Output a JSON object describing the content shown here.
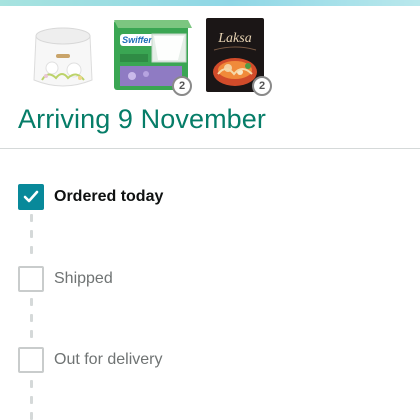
{
  "shipment": {
    "items": [
      {
        "icon": "cotton-pads-product-image",
        "quantity": ""
      },
      {
        "icon": "swiffer-cloths-product-image",
        "brand": "Swiffer",
        "quantity": "2"
      },
      {
        "icon": "laksa-noodles-product-image",
        "brand": "Laksa",
        "quantity": "2"
      }
    ],
    "arriving_text": "Arriving 9 November"
  },
  "tracker": {
    "steps": [
      {
        "label": "Ordered today",
        "completed": true
      },
      {
        "label": "Shipped",
        "completed": false
      },
      {
        "label": "Out for delivery",
        "completed": false
      }
    ]
  },
  "colors": {
    "accent_teal": "#067d68",
    "check_fill": "#08899a",
    "divider": "#d5d9d9"
  }
}
